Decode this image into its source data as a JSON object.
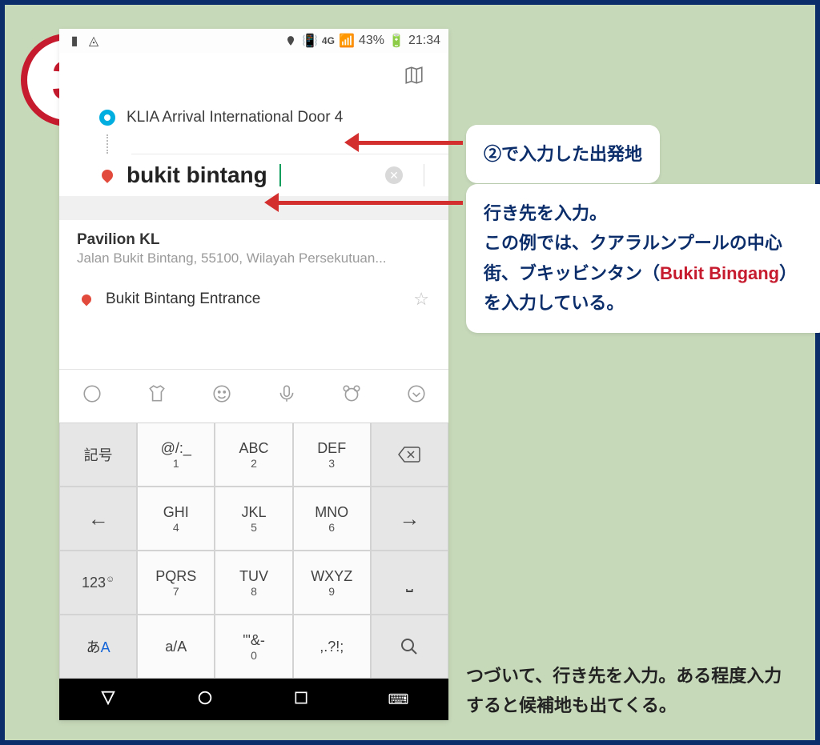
{
  "step": "3",
  "statusbar": {
    "battery": "43%",
    "time": "21:34",
    "net": "4G"
  },
  "locations": {
    "origin": "KLIA Arrival International Door 4",
    "dest": "bukit bintang"
  },
  "suggestion": {
    "title": "Pavilion KL",
    "sub": "Jalan Bukit Bintang, 55100, Wilayah Persekutuan...",
    "item": "Bukit Bintang Entrance"
  },
  "keys": {
    "r1": [
      "記号",
      "@/:_\n1",
      "ABC\n2",
      "DEF\n3",
      "⌫"
    ],
    "r2": [
      "←",
      "GHI\n4",
      "JKL\n5",
      "MNO\n6",
      "→"
    ],
    "r3": [
      "123☺",
      "PQRS\n7",
      "TUV\n8",
      "WXYZ\n9",
      "␣"
    ],
    "r4": [
      "あA",
      "a/A",
      "'\"&-\n0",
      ",.?!;",
      "🔍"
    ]
  },
  "toolbar": [
    "💬",
    "👕",
    "☺",
    "🎤",
    "🐻",
    "⌄"
  ],
  "annot": {
    "a1": "②で入力した出発地",
    "a2_1": "行き先を入力。",
    "a2_2": "この例では、クアラルンプールの中心街、ブキッビンタン（",
    "a2_red": "Bukit Bingang",
    "a2_3": "）を入力している。"
  },
  "caption": "つづいて、行き先を入力。ある程度入力すると候補地も出てくる。"
}
